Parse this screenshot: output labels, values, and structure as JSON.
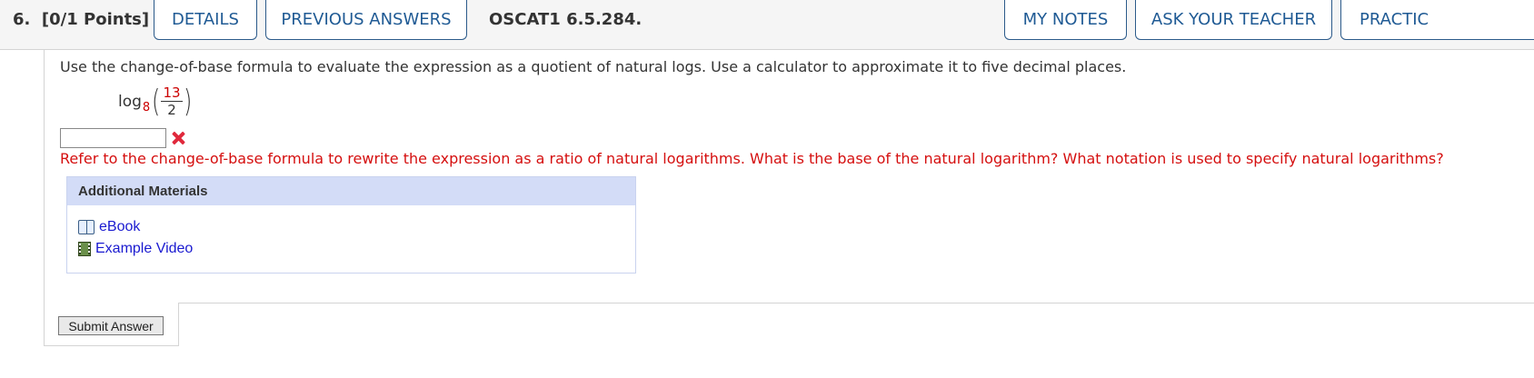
{
  "header": {
    "question_number": "6.",
    "points": "[0/1 Points]",
    "details_label": "DETAILS",
    "previous_answers_label": "PREVIOUS ANSWERS",
    "question_id": "OSCAT1 6.5.284.",
    "my_notes_label": "MY NOTES",
    "ask_teacher_label": "ASK YOUR TEACHER",
    "practice_label": "PRACTIC"
  },
  "question": {
    "prompt": "Use the change-of-base formula to evaluate the expression as a quotient of natural logs. Use a calculator to approximate it to five decimal places.",
    "expression": {
      "func": "log",
      "base": "8",
      "numerator": "13",
      "denominator": "2"
    },
    "answer_value": "",
    "feedback": "Refer to the change-of-base formula to rewrite the expression as a ratio of natural logarithms. What is the base of the natural logarithm? What notation is used to specify natural logarithms?"
  },
  "additional_materials": {
    "title": "Additional Materials",
    "items": [
      {
        "label": "eBook",
        "icon": "book-icon"
      },
      {
        "label": "Example Video",
        "icon": "film-icon"
      }
    ]
  },
  "submit_label": "Submit Answer",
  "colors": {
    "accent": "#1f5a94",
    "error": "#d50f0f",
    "materials_header": "#d3dcf7",
    "link": "#1a1ad0"
  }
}
